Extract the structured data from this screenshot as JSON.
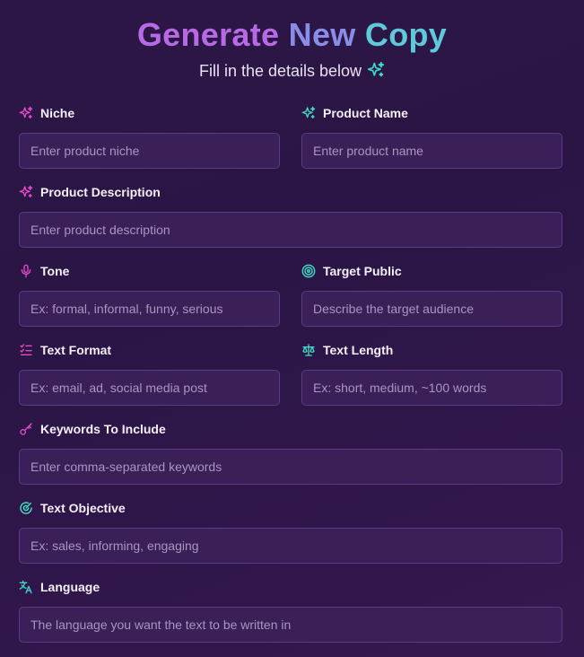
{
  "header": {
    "title_parts": [
      "Generate",
      "New",
      "Copy"
    ],
    "subtitle": "Fill in the details below",
    "subtitle_icon": "sparkles-icon"
  },
  "colors": {
    "pink_icon": "#e64bc9",
    "teal_icon": "#3fd9c4",
    "title_gradient": [
      "#b86ae6",
      "#8a8de8",
      "#5fc9d9"
    ]
  },
  "fields": {
    "niche": {
      "label": "Niche",
      "placeholder": "Enter product niche",
      "icon": "sparkles-icon"
    },
    "product_name": {
      "label": "Product Name",
      "placeholder": "Enter product name",
      "icon": "sparkles-icon"
    },
    "product_description": {
      "label": "Product Description",
      "placeholder": "Enter product description",
      "icon": "sparkles-icon"
    },
    "tone": {
      "label": "Tone",
      "placeholder": "Ex: formal, informal, funny, serious",
      "icon": "microphone-icon"
    },
    "target_public": {
      "label": "Target Public",
      "placeholder": "Describe the target audience",
      "icon": "target-icon"
    },
    "text_format": {
      "label": "Text Format",
      "placeholder": "Ex: email, ad, social media post",
      "icon": "checklist-icon"
    },
    "text_length": {
      "label": "Text Length",
      "placeholder": "Ex: short, medium, ~100 words",
      "icon": "scale-icon"
    },
    "keywords": {
      "label": "Keywords To Include",
      "placeholder": "Enter comma-separated keywords",
      "icon": "key-icon"
    },
    "objective": {
      "label": "Text Objective",
      "placeholder": "Ex: sales, informing, engaging",
      "icon": "goal-icon"
    },
    "language": {
      "label": "Language",
      "placeholder": "The language you want the text to be written in",
      "icon": "translate-icon"
    }
  }
}
